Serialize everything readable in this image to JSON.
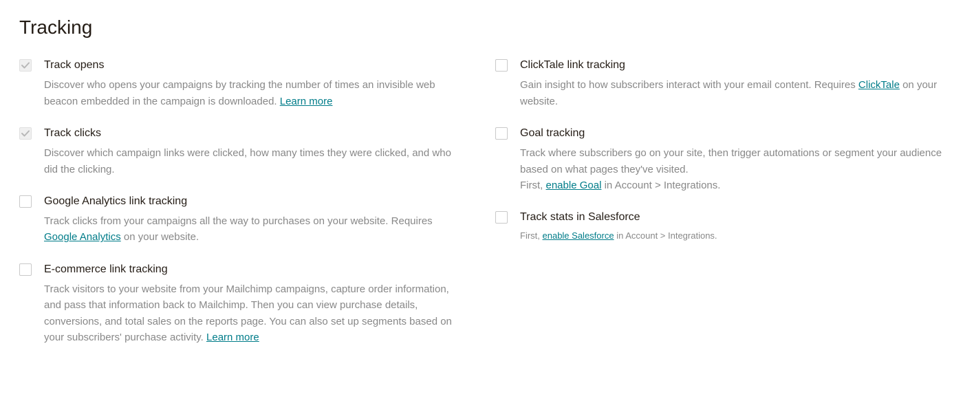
{
  "heading": "Tracking",
  "left": [
    {
      "id": "track-opens",
      "checked": true,
      "disabled": true,
      "title": "Track opens",
      "desc_pre": "Discover who opens your campaigns by tracking the number of times an invisible web beacon embedded in the campaign is downloaded. ",
      "link": "Learn more",
      "desc_post": ""
    },
    {
      "id": "track-clicks",
      "checked": true,
      "disabled": true,
      "title": "Track clicks",
      "desc_pre": "Discover which campaign links were clicked, how many times they were clicked, and who did the clicking.",
      "link": "",
      "desc_post": ""
    },
    {
      "id": "ga-tracking",
      "checked": false,
      "disabled": false,
      "title": "Google Analytics link tracking",
      "desc_pre": "Track clicks from your campaigns all the way to purchases on your website. Requires ",
      "link": "Google Analytics",
      "desc_post": " on your website."
    },
    {
      "id": "ecommerce-tracking",
      "checked": false,
      "disabled": false,
      "title": " E-commerce link tracking",
      "desc_pre": "Track visitors to your website from your Mailchimp campaigns, capture order information, and pass that information back to Mailchimp. Then you can view purchase details, conversions, and total sales on the reports page. You can also set up segments based on your subscribers' purchase activity. ",
      "link": "Learn more",
      "desc_post": ""
    }
  ],
  "right": [
    {
      "id": "clicktale-tracking",
      "checked": false,
      "disabled": false,
      "title": "ClickTale link tracking",
      "desc_pre": "Gain insight to how subscribers interact with your email content. Requires ",
      "link": "ClickTale",
      "desc_post": " on your website.",
      "desc_small": false
    },
    {
      "id": "goal-tracking",
      "checked": false,
      "disabled": false,
      "title": "Goal tracking",
      "desc_pre": "Track where subscribers go on your site, then trigger automations or segment your audience based on what pages they've visited.",
      "desc_pre2": "First, ",
      "link": "enable Goal",
      "desc_post": " in Account > Integrations.",
      "desc_small": false
    },
    {
      "id": "salesforce-tracking",
      "checked": false,
      "disabled": false,
      "title": "Track stats in Salesforce",
      "desc_pre": "First, ",
      "link": "enable Salesforce",
      "desc_post": " in Account > Integrations.",
      "desc_small": true
    }
  ]
}
